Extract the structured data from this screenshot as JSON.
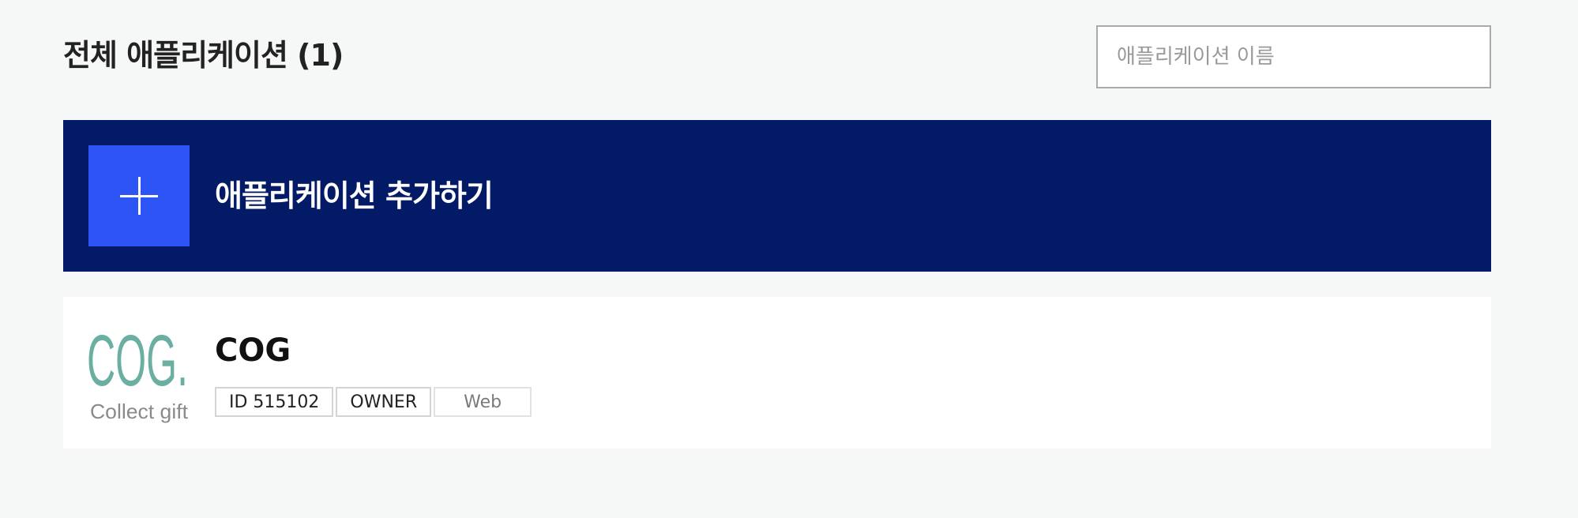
{
  "header": {
    "title": "전체 애플리케이션 (1)"
  },
  "search": {
    "placeholder": "애플리케이션 이름",
    "value": ""
  },
  "add_app": {
    "label": "애플리케이션 추가하기",
    "icon": "plus-icon"
  },
  "apps": [
    {
      "name": "COG",
      "logo": {
        "text": "COG.",
        "tagline": "Collect gift"
      },
      "tags": {
        "id": "ID 515102",
        "role": "OWNER",
        "platform": "Web"
      }
    }
  ],
  "colors": {
    "background": "#f6f7f7",
    "banner": "#031a66",
    "accent": "#2d55f5",
    "logo_teal": "#6aafa2",
    "logo_gray": "#8a8a8a"
  }
}
